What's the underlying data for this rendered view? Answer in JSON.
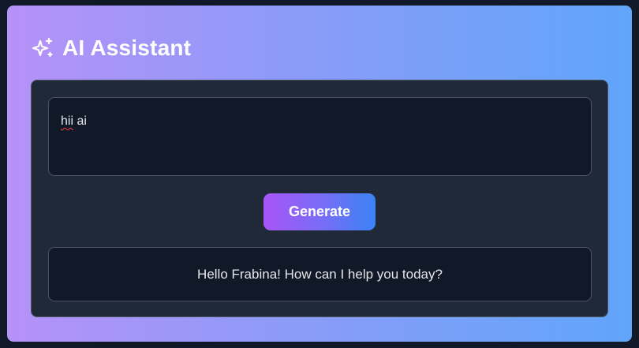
{
  "app": {
    "title": "AI Assistant",
    "title_icon": "sparkles-icon"
  },
  "prompt": {
    "word_misspelled": "hii",
    "word_rest": " ai"
  },
  "actions": {
    "generate_label": "Generate"
  },
  "response": {
    "text": "Hello Frabina! How can I help you today?"
  },
  "colors": {
    "page_background": "#111827",
    "gradient_start": "#b691f8",
    "gradient_end": "#60a5fa",
    "panel": "#1f2937",
    "field": "#111827",
    "border": "#4b5563",
    "button_start": "#a855f7",
    "button_end": "#3b82f6",
    "spell_error": "#ef4444"
  }
}
